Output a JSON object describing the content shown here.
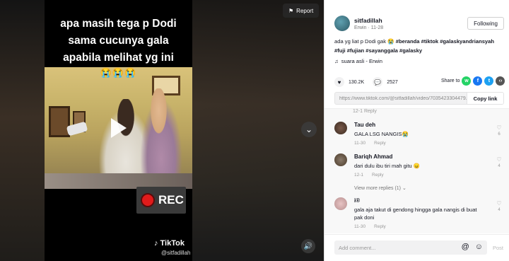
{
  "video": {
    "caption_lines": [
      "apa masih tega p Dodi",
      "sama cucunya gala",
      "apabila melihat yg ini"
    ],
    "caption_emoji": "😭😭😭",
    "rec_label": "REC",
    "watermark_brand": "TikTok",
    "watermark_user": "@sitfadillah",
    "report_label": "Report"
  },
  "post": {
    "author_name": "sitfadillah",
    "author_sub": "Erwin · 11-28",
    "follow_label": "Following",
    "description": "ada yg liat p Dodi gak 😭",
    "hashtags": "#beranda #tiktok #galaskyandriansyah #fuji #fujian #sayanggala #galasky",
    "music": "suara asli - Erwin",
    "likes": "130.2K",
    "comments_count": "2527",
    "share_label": "Share to",
    "link_url": "https://www.tiktok.com/@sitfadillah/video/7035423304479...",
    "copy_label": "Copy link"
  },
  "comments": {
    "cutoff_meta": "12-1    Reply",
    "items": [
      {
        "user": "Tau deh",
        "text": "GALA LSG NANGIS😭",
        "date": "11-30",
        "reply": "Reply",
        "likes": "6"
      },
      {
        "user": "Bariqh Ahmad",
        "text": "dari dulu ibu tiri mah gitu 😠",
        "date": "12-1",
        "reply": "Reply",
        "likes": "4"
      },
      {
        "user": "i®",
        "text": "gala aja takut di gendong hingga gala nangis di buat pak doni",
        "date": "11-30",
        "reply": "Reply",
        "likes": "4"
      }
    ],
    "view_more": "View more replies (1)",
    "add_placeholder": "Add comment...",
    "post_label": "Post"
  }
}
